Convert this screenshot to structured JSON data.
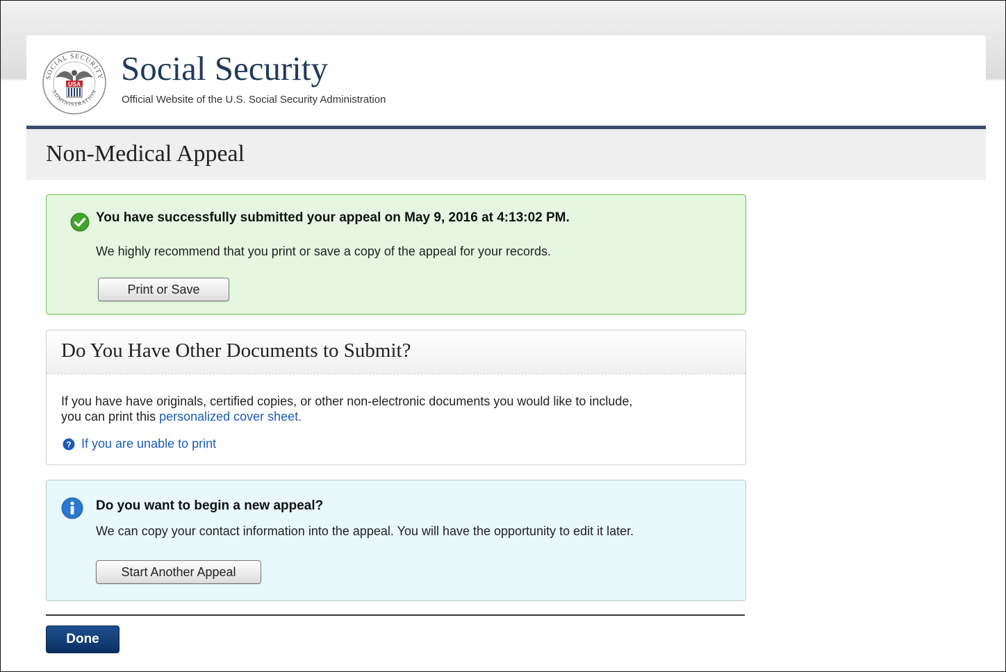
{
  "header": {
    "brand_name": "Social Security",
    "tagline": "Official Website of the U.S. Social Security Administration",
    "seal": {
      "ring_text_top": "SOCIAL SECURITY",
      "ring_text_bottom": "ADMINISTRATION",
      "shield_text": "USA"
    }
  },
  "page_title": "Non-Medical Appeal",
  "success_alert": {
    "icon": "checkmark-circle-icon",
    "headline": "You have successfully submitted your appeal on May 9, 2016 at 4:13:02 PM.",
    "message": "We highly recommend that you print or save a copy of the appeal for your records.",
    "button_label": "Print or Save"
  },
  "documents_panel": {
    "title": "Do You Have Other Documents to Submit?",
    "text_line1": "If you have have originals, certified copies, or other non-electronic documents you would like to include,",
    "text_line2_prefix": "you can print this ",
    "link_label": "personalized cover sheet.",
    "help_icon": "question-circle-icon",
    "help_link_label": "If you are unable to print"
  },
  "info_alert": {
    "icon": "info-circle-icon",
    "headline": "Do you want to begin a new appeal?",
    "message": "We can copy your contact information into the appeal. You will have the opportunity to edit it later.",
    "button_label": "Start Another Appeal"
  },
  "done_label": "Done",
  "colors": {
    "brand_navy": "#1f3a5b",
    "header_rule": "#3b4a68",
    "success_bg": "#e5f7e0",
    "success_border": "#6cc24a",
    "info_bg": "#e8f8fb",
    "link": "#1c5cb9",
    "done_button": "#0c2f63"
  }
}
